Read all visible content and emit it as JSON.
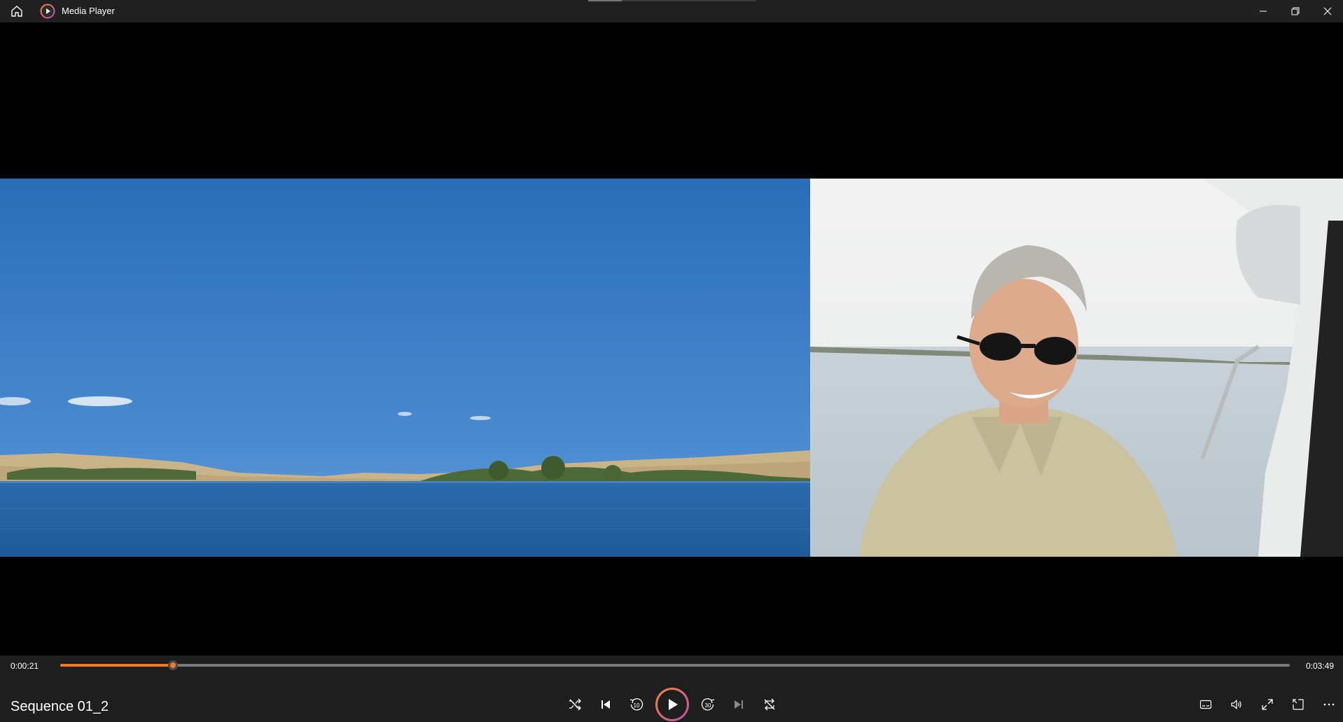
{
  "window": {
    "title": "Media Player",
    "minimize_icon": "minimize-icon",
    "maximize_icon": "restore-icon",
    "close_icon": "close-icon",
    "home_icon": "home-icon",
    "app_icon": "media-player-icon"
  },
  "video": {
    "left_scene": "lake-landscape",
    "right_scene": "man-in-sunglasses-on-boat"
  },
  "playback": {
    "current_time": "0:00:21",
    "total_time": "0:03:49",
    "progress_fraction": 0.0917,
    "title": "Sequence 01_2"
  },
  "colors": {
    "accent": "#f07a2a",
    "accent_gradient_end": "#c44ab0",
    "titlebar_bg": "#202020",
    "controls_bg": "#1e1e1e"
  },
  "controls": {
    "shuffle_icon": "shuffle-icon",
    "previous_icon": "previous-icon",
    "skip_back_icon": "skip-back-10-icon",
    "skip_back_label": "10",
    "play_icon": "play-icon",
    "skip_forward_icon": "skip-forward-30-icon",
    "skip_forward_label": "30",
    "next_icon": "next-icon",
    "repeat_icon": "repeat-off-icon",
    "captions_icon": "captions-icon",
    "volume_icon": "volume-icon",
    "fullscreen_icon": "fullscreen-icon",
    "miniplayer_icon": "miniplayer-icon",
    "more_icon": "more-icon"
  }
}
